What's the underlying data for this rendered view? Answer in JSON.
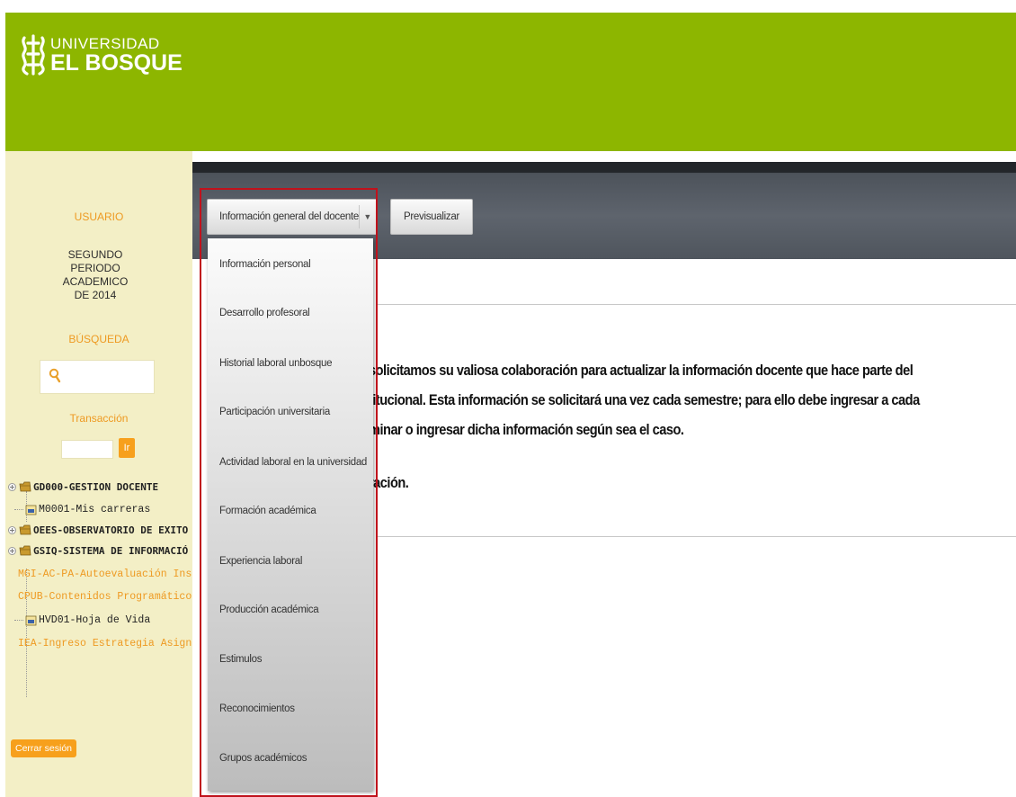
{
  "header": {
    "logo_top": "UNIVERSIDAD",
    "logo_main": "EL BOSQUE",
    "bg_color": "#8db600"
  },
  "sidebar": {
    "usuario_label": "USUARIO",
    "periodo_lines": [
      "SEGUNDO",
      "PERIODO",
      "ACADEMICO",
      "DE 2014"
    ],
    "busqueda_label": "BÚSQUEDA",
    "search_value": "",
    "transaccion_label": "Transacción",
    "transaccion_value": "",
    "go_label": "Ir",
    "tree": [
      {
        "label": "GD000-GESTION DOCENTE",
        "type": "folder"
      },
      {
        "label": "M0001-Mis carreras",
        "type": "doc"
      },
      {
        "label": "OEES-OBSERVATORIO DE EXITO",
        "type": "folder"
      },
      {
        "label": "GSIQ-SISTEMA DE INFORMACIÓ",
        "type": "folder"
      },
      {
        "label": "MGI-AC-PA-Autoevaluación Instit",
        "type": "doc"
      },
      {
        "label": "CPUB-Contenidos Programáticos",
        "type": "doc"
      },
      {
        "label": "HVD01-Hoja de Vida",
        "type": "doc"
      },
      {
        "label": "IEA-Ingreso Estrategia Asignatura",
        "type": "doc"
      }
    ],
    "logout_label": "Cerrar sesión",
    "accent_color": "#ee9a22"
  },
  "toolbar": {
    "dropdown_selected": "Información general del docente",
    "preview_label": "Previsualizar"
  },
  "dropdown_menu": {
    "items": [
      "Información personal",
      "Desarrollo profesoral",
      "Historial laboral unbosque",
      "Participación universitaria",
      "Actividad laboral en la universidad",
      "Formación académica",
      "Experiencia laboral",
      "Producción académica",
      "Estimulos",
      "Reconocimientos",
      "Grupos académicos"
    ]
  },
  "main": {
    "lines": [
      "solicitamos su valiosa colaboración para actualizar la información docente que hace parte del",
      "titucional. Esta información se solicitará una vez cada semestre; para ello debe ingresar a cada",
      "minar o ingresar dicha información según sea el caso.",
      "ración."
    ]
  }
}
